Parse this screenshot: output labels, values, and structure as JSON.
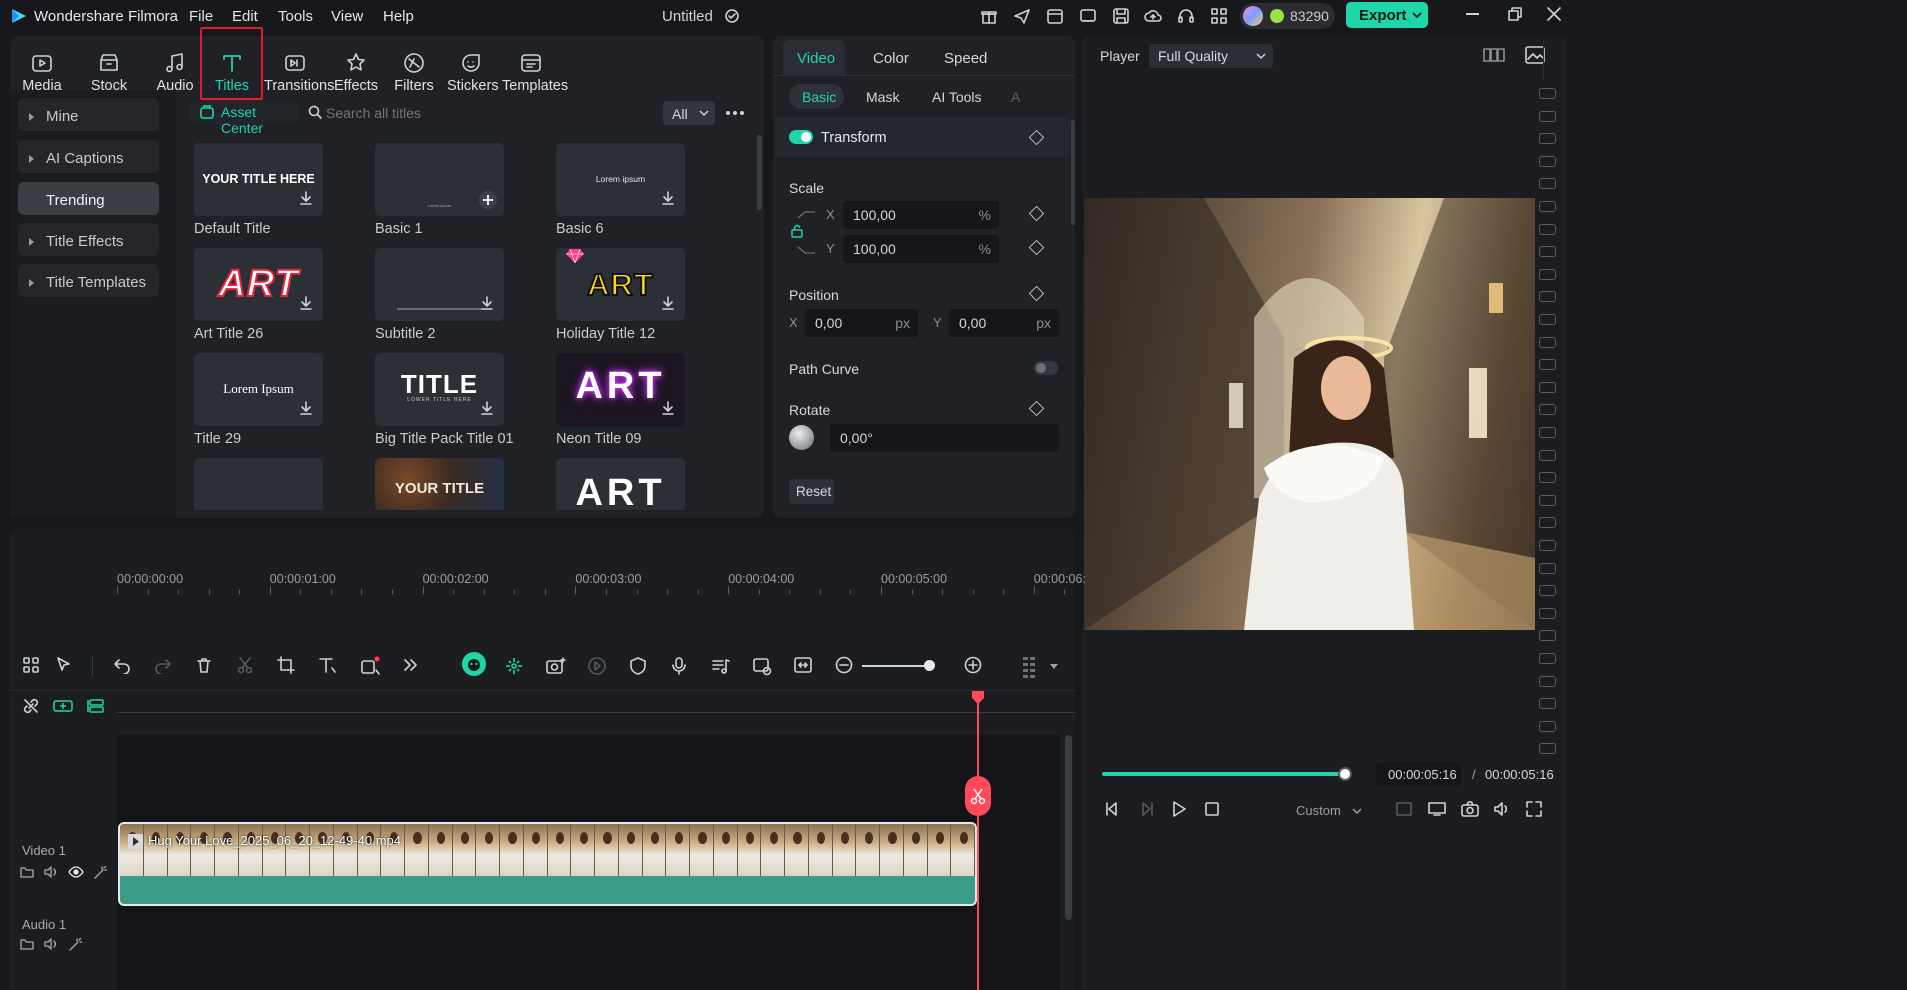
{
  "app": {
    "name": "Wondershare Filmora",
    "doc_title": "Untitled",
    "credits": "83290",
    "export_label": "Export"
  },
  "menu": [
    "File",
    "Edit",
    "Tools",
    "View",
    "Help"
  ],
  "toolbar": [
    {
      "label": "Media",
      "icon": "media-icon"
    },
    {
      "label": "Stock Media",
      "icon": "stock-media-icon"
    },
    {
      "label": "Audio",
      "icon": "audio-icon"
    },
    {
      "label": "Titles",
      "icon": "titles-icon"
    },
    {
      "label": "Transitions",
      "icon": "transitions-icon"
    },
    {
      "label": "Effects",
      "icon": "effects-icon"
    },
    {
      "label": "Filters",
      "icon": "filters-icon"
    },
    {
      "label": "Stickers",
      "icon": "stickers-icon"
    },
    {
      "label": "Templates",
      "icon": "templates-icon"
    }
  ],
  "sidebar": {
    "items": [
      {
        "label": "Mine"
      },
      {
        "label": "AI Captions"
      },
      {
        "label": "Trending"
      },
      {
        "label": "Title Effects"
      },
      {
        "label": "Title Templates"
      }
    ]
  },
  "assets": {
    "asset_center": "Asset Center",
    "search_placeholder": "Search all titles",
    "filter": "All",
    "cards": [
      {
        "label": "Default Title",
        "preview": "YOUR TITLE HERE"
      },
      {
        "label": "Basic 1",
        "preview": "Lorem ipsum"
      },
      {
        "label": "Basic 6",
        "preview": "Lorem ipsum"
      },
      {
        "label": "Art Title 26",
        "preview": "ART"
      },
      {
        "label": "Subtitle 2",
        "preview": ""
      },
      {
        "label": "Holiday Title 12",
        "preview": "ART"
      },
      {
        "label": "Title 29",
        "preview": "Lorem Ipsum"
      },
      {
        "label": "Big Title Pack Title 01",
        "preview": "TITLE",
        "sub": "LOWER TITLE HERE"
      },
      {
        "label": "Neon Title 09",
        "preview": "ART"
      },
      {
        "label": "",
        "preview": ""
      },
      {
        "label": "",
        "preview": "YOUR TITLE"
      },
      {
        "label": "",
        "preview": "ART"
      }
    ]
  },
  "props": {
    "tabs": [
      "Video",
      "Color",
      "Speed"
    ],
    "subtabs": [
      "Basic",
      "Mask",
      "AI Tools",
      "A"
    ],
    "transform": "Transform",
    "scale": "Scale",
    "x_label": "X",
    "y_label": "Y",
    "scale_x": "100,00",
    "scale_y": "100,00",
    "pct": "%",
    "position": "Position",
    "pos_x": "0,00",
    "pos_y": "0,00",
    "px": "px",
    "path_curve": "Path Curve",
    "rotate": "Rotate",
    "rotate_val": "0,00°",
    "reset": "Reset"
  },
  "player": {
    "label": "Player",
    "quality": "Full Quality",
    "current": "00:00:05:16",
    "sep": "/",
    "total": "00:00:05:16",
    "custom": "Custom",
    "progress": 0.98
  },
  "timeline": {
    "ruler": [
      "00:00:00:00",
      "00:00:01:00",
      "00:00:02:00",
      "00:00:03:00",
      "00:00:04:00",
      "00:00:05:00",
      "00:00:06:"
    ],
    "video_track": "Video 1",
    "audio_track": "Audio 1",
    "clip": "Hug Your Love_2025_06_20_12-49-40.mp4"
  },
  "colors": {
    "accent": "#1fd6a8",
    "playhead": "#ff4a5a",
    "highlight": "#e21b2a"
  }
}
